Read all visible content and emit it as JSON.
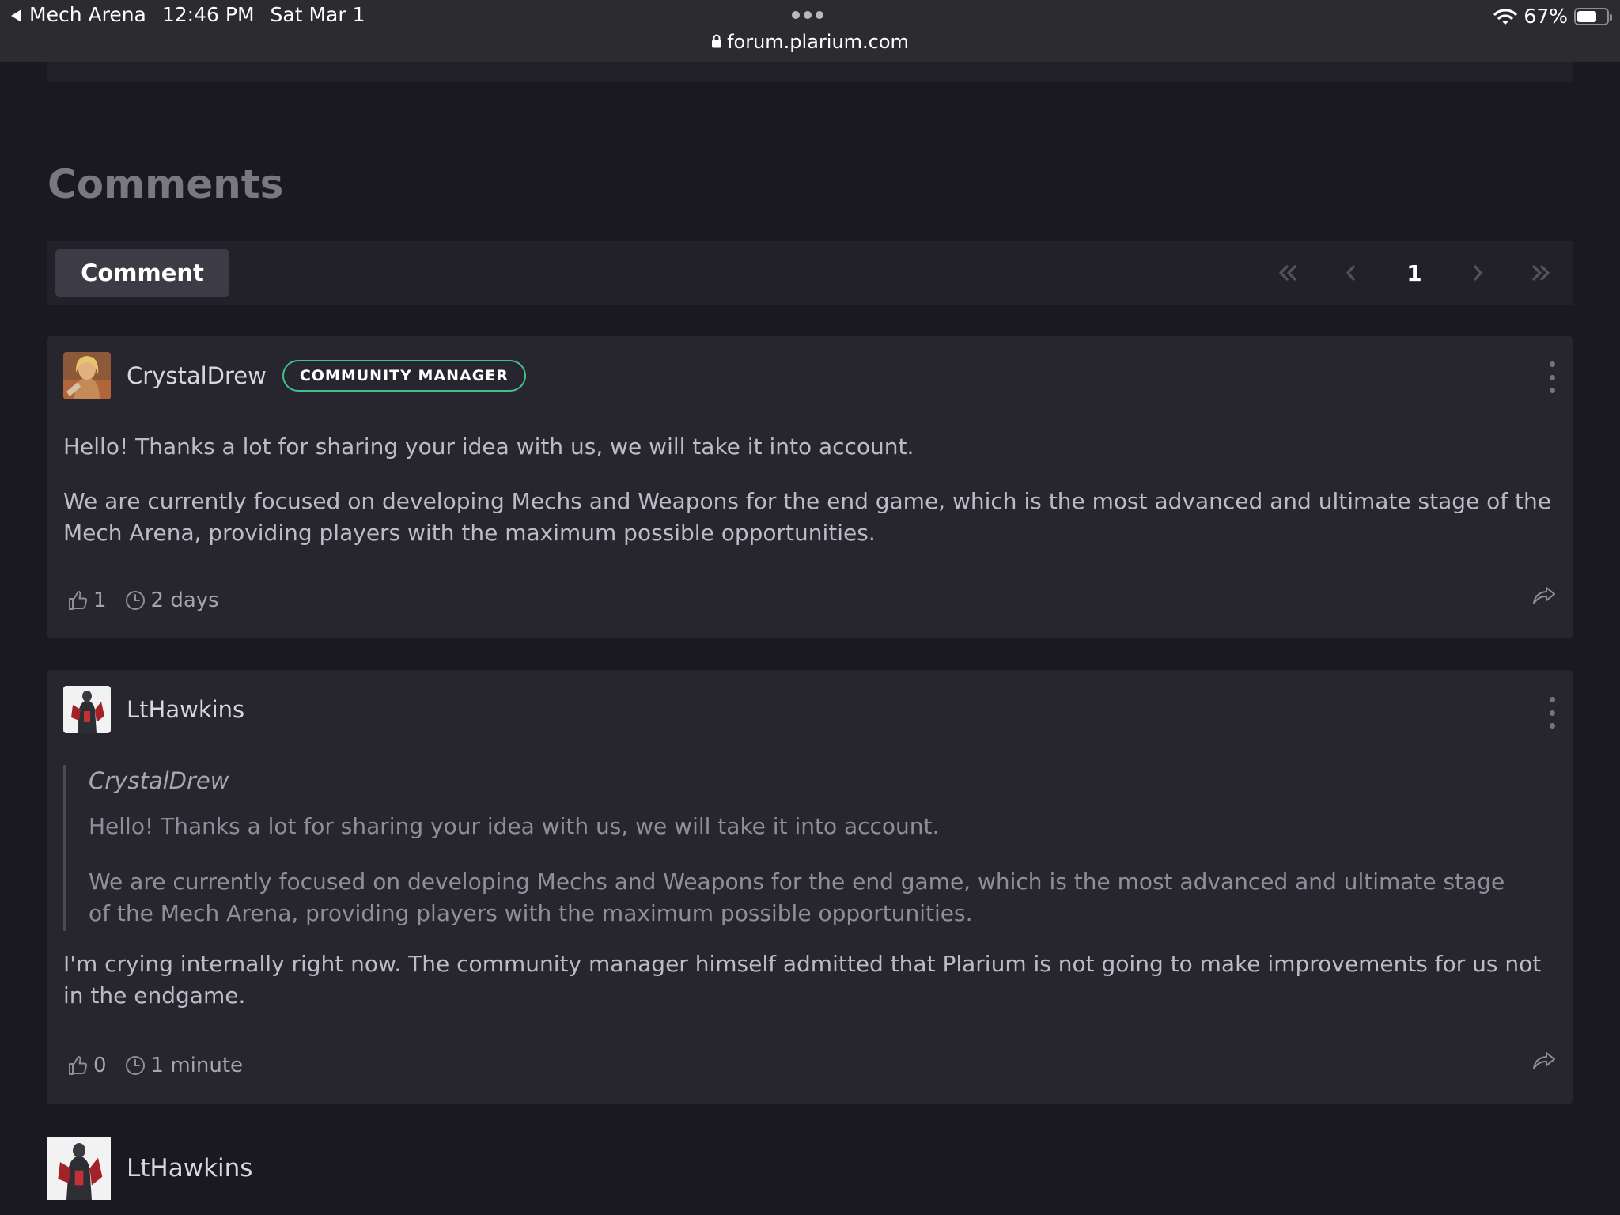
{
  "status_bar": {
    "back_app": "Mech Arena",
    "time": "12:46 PM",
    "date": "Sat Mar 1",
    "url": "forum.plarium.com",
    "battery": "67%",
    "battery_level": 0.67
  },
  "comments_section": {
    "title": "Comments",
    "comment_button": "Comment",
    "pagination": {
      "current_page": "1"
    }
  },
  "comments": [
    {
      "author": "CrystalDrew",
      "badge": "COMMUNITY MANAGER",
      "paragraphs": [
        "Hello! Thanks a lot for sharing your idea with us, we will take it into account.",
        "We are currently focused on developing Mechs and Weapons for the end game, which is the most advanced and ultimate stage of the Mech Arena, providing players with the maximum possible opportunities."
      ],
      "likes": "1",
      "time": "2 days"
    },
    {
      "author": "LtHawkins",
      "quote": {
        "author": "CrystalDrew",
        "paragraphs": [
          "Hello! Thanks a lot for sharing your idea with us, we will take it into account.",
          "We are currently focused on developing Mechs and Weapons for the end game, which is the most advanced and ultimate stage of the Mech Arena, providing players with the maximum possible opportunities."
        ]
      },
      "paragraphs": [
        "I'm crying internally right now. The community manager himself admitted that Plarium is not going to make improvements for us not in the endgame."
      ],
      "likes": "0",
      "time": "1 minute"
    },
    {
      "author": "LtHawkins"
    }
  ],
  "colors": {
    "background": "#1a1920",
    "card": "#27262f",
    "badge_border": "#3ec48b"
  }
}
